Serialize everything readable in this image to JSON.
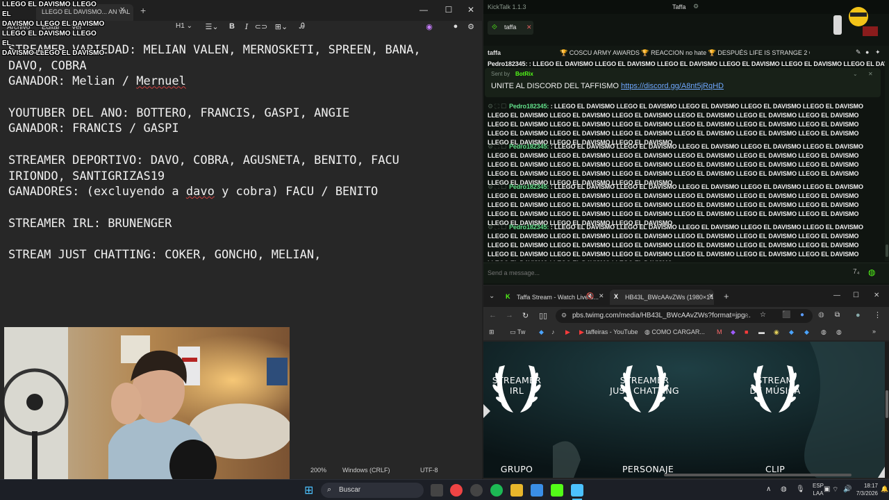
{
  "overlay": {
    "lines": [
      "LLEGO EL DAVISMO LLEGO EL",
      "DAVISMO LLEGO EL DAVISMO",
      "LLEGO EL DAVISMO LLEGO EL",
      "DAVISMO LLEGO EL DAVISMO"
    ]
  },
  "notepad": {
    "tab_title": "LLEGO EL DAVISMO... AN VAL",
    "menu": [
      "Archivo",
      "Editar",
      "Ver"
    ],
    "heading_select": "H1",
    "lines": [
      [
        "STREAMER VARIEDAD: MELIAN VALEN, MERNOSKETI, SPREEN, BANA,"
      ],
      [
        "DAVO, COBRA"
      ],
      [
        "GANADOR: Melian / ",
        "Mernuel"
      ],
      [
        ""
      ],
      [
        "YOUTUBER DEL ANO: BOTTERO, FRANCIS, GASPI, ANGIE"
      ],
      [
        "GANADOR: FRANCIS / GASPI"
      ],
      [
        ""
      ],
      [
        "STREAMER DEPORTIVO: DAVO, COBRA, AGUSNETA, BENITO, FACU"
      ],
      [
        "IRIONDO, SANTIGRIZAS19"
      ],
      [
        "GANADORES: (excluyendo a ",
        "davo",
        " y cobra) FACU / BENITO"
      ],
      [
        ""
      ],
      [
        "STREAMER IRL: BRUNENGER"
      ],
      [
        ""
      ],
      [
        "STREAM JUST CHATTING: COKER, GONCHO, MELIAN,"
      ]
    ],
    "status": {
      "zoom": "200%",
      "line_ending": "Windows (CRLF)",
      "encoding": "UTF-8"
    }
  },
  "kicktalk": {
    "app_title": "KickTalk 1.1.3",
    "center_title": "Taffa",
    "tab": "taffa",
    "channel": "taffa",
    "ticker": "🏆 COSCU ARMY AWARDS 🏆 REACCION no hate 🏆 DESPUÉS LIFE IS STRANGE 2 CA...",
    "top_partial": "Pedro182345: : LLEGO EL DAVISMO LLEGO EL DAVISMO LLEGO EL DAVISMO LLEGO EL DAVISMO LLEGO EL DAVISMO LLEGO EL DAVISMO LLEGO EL DAVISMO LLEGO EL",
    "pinned": {
      "sent_by": "Sent by",
      "bot": "BotRix",
      "text": "UNITE AL DISCORD DEL TAFFISMO ",
      "link": "https://discord.gg/A8nt5jRqHD"
    },
    "messages": [
      {
        "user": "Pedro182345:",
        "text": " : LLEGO EL DAVISMO LLEGO EL DAVISMO LLEGO EL DAVISMO LLEGO EL DAVISMO LLEGO EL DAVISMO LLEGO EL DAVISMO LLEGO EL DAVISMO LLEGO EL DAVISMO LLEGO EL DAVISMO LLEGO EL DAVISMO LLEGO EL DAVISMO LLEGO EL DAVISMO LLEGO EL DAVISMO LLEGO EL DAVISMO LLEGO EL DAVISMO LLEGO EL DAVISMO LLEGO EL DAVISMO LLEGO EL DAVISMO LLEGO EL DAVISMO LLEGO EL DAVISMO LLEGO EL DAVISMO LLEGO EL DAVISMO LLEGO EL DAVISMO LLEGO EL DAVISMO LLEGO EL DAVISMO LLEGO EL DAVISMO"
      },
      {
        "user": "Pedro182345:",
        "text": " : LLEGO EL DAVISMO LLEGO EL DAVISMO LLEGO EL DAVISMO LLEGO EL DAVISMO LLEGO EL DAVISMO LLEGO EL DAVISMO LLEGO EL DAVISMO LLEGO EL DAVISMO LLEGO EL DAVISMO LLEGO EL DAVISMO LLEGO EL DAVISMO LLEGO EL DAVISMO LLEGO EL DAVISMO LLEGO EL DAVISMO LLEGO EL DAVISMO LLEGO EL DAVISMO LLEGO EL DAVISMO LLEGO EL DAVISMO LLEGO EL DAVISMO LLEGO EL DAVISMO LLEGO EL DAVISMO LLEGO EL DAVISMO LLEGO EL DAVISMO LLEGO EL DAVISMO LLEGO EL DAVISMO LLEGO EL DAVISMO"
      },
      {
        "user": "Pedro182345:",
        "text": " : LLEGO EL DAVISMO LLEGO EL DAVISMO LLEGO EL DAVISMO LLEGO EL DAVISMO LLEGO EL DAVISMO LLEGO EL DAVISMO LLEGO EL DAVISMO LLEGO EL DAVISMO LLEGO EL DAVISMO LLEGO EL DAVISMO LLEGO EL DAVISMO LLEGO EL DAVISMO LLEGO EL DAVISMO LLEGO EL DAVISMO LLEGO EL DAVISMO LLEGO EL DAVISMO LLEGO EL DAVISMO LLEGO EL DAVISMO LLEGO EL DAVISMO LLEGO EL DAVISMO LLEGO EL DAVISMO LLEGO EL DAVISMO LLEGO EL DAVISMO LLEGO EL DAVISMO LLEGO EL DAVISMO LLEGO EL DAVISMO"
      },
      {
        "user": "Pedro182345:",
        "text": " : LLEGO EL DAVISMO LLEGO EL DAVISMO LLEGO EL DAVISMO LLEGO EL DAVISMO LLEGO EL DAVISMO LLEGO EL DAVISMO LLEGO EL DAVISMO LLEGO EL DAVISMO LLEGO EL DAVISMO LLEGO EL DAVISMO LLEGO EL DAVISMO LLEGO EL DAVISMO LLEGO EL DAVISMO LLEGO EL DAVISMO LLEGO EL DAVISMO LLEGO EL DAVISMO LLEGO EL DAVISMO LLEGO EL DAVISMO LLEGO EL DAVISMO LLEGO EL DAVISMO LLEGO EL DAVISMO LLEGO EL DAVISMO LLEGO EL DAVISMO LLEGO EL DAVISMO LLEGO EL DAVISMO LLEGO EL DAVISMO"
      }
    ],
    "send_placeholder": "Send a message...",
    "accent": "#53fc18"
  },
  "chrome": {
    "tabs": [
      {
        "title": "Taffa Stream - Watch Live o..."
      },
      {
        "title": "HB43L_BWcAAvZWs (1980×14..."
      }
    ],
    "url": "pbs.twimg.com/media/HB43L_BWcAAvZWs?format=jpg...",
    "bookmarks": [
      "Tw",
      "taffeiras - YouTube",
      "COMO CARGAR..."
    ],
    "awards_row1": [
      [
        "STREAMER",
        "IRL"
      ],
      [
        "STREAMER",
        "JUST CHATTING"
      ],
      [
        "STREAM",
        "DE MÚSICA"
      ]
    ],
    "awards_row2": [
      "GRUPO",
      "PERSONAJE",
      "CLIP"
    ]
  },
  "taskbar": {
    "search": "Buscar",
    "lang": [
      "ESP",
      "LAA"
    ],
    "time": "18:17",
    "date": "7/3/2026"
  }
}
